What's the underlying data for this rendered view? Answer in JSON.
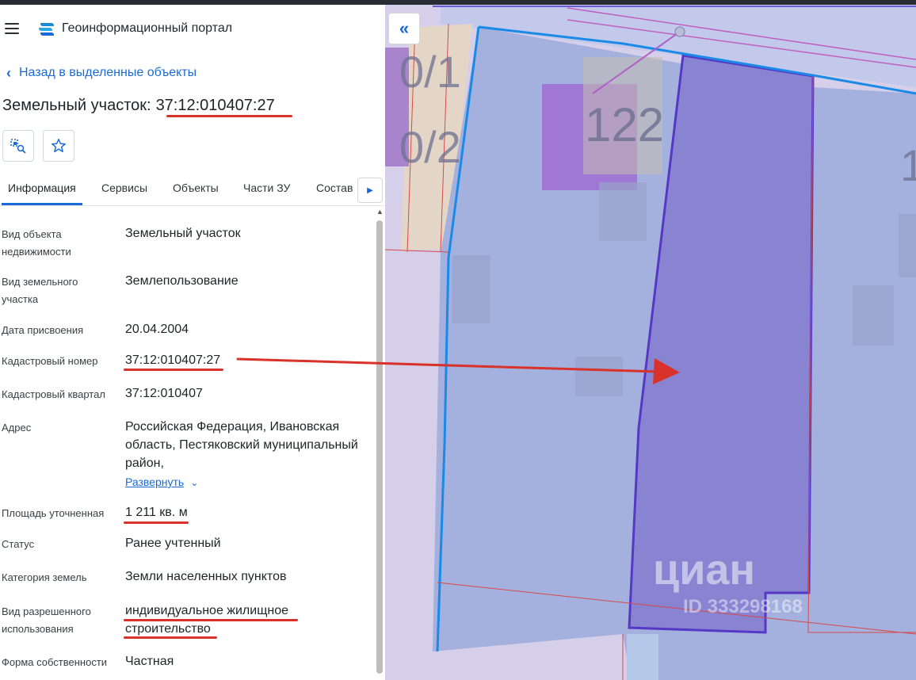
{
  "header": {
    "title": "Геоинформационный портал"
  },
  "back": {
    "label": "Назад в выделенные объекты"
  },
  "object": {
    "type": "Земельный участок:",
    "number": "37:12:010407:27"
  },
  "tabs": [
    "Информация",
    "Сервисы",
    "Объекты",
    "Части ЗУ",
    "Состав"
  ],
  "fields": [
    {
      "label": "Вид объекта недвижимости",
      "value": "Земельный участок"
    },
    {
      "label": "Вид земельного участка",
      "value": "Землепользование"
    },
    {
      "label": "Дата присвоения",
      "value": "20.04.2004"
    },
    {
      "label": "Кадастровый номер",
      "value": "37:12:010407:27"
    },
    {
      "label": "Кадастровый квартал",
      "value": "37:12:010407"
    },
    {
      "label": "Адрес",
      "value": "Российская Федерация, Ивановская область, Пестяковский муниципальный район,",
      "action": "Развернуть"
    },
    {
      "label": "Площадь уточненная",
      "value": "1 211 кв. м"
    },
    {
      "label": "Статус",
      "value": "Ранее учтенный"
    },
    {
      "label": "Категория земель",
      "value": "Земли населенных пунктов"
    },
    {
      "label": "Вид разрешенного использования",
      "value": "индивидуальное жилищное строительство"
    },
    {
      "label": "Форма собственности",
      "value": "Частная"
    }
  ],
  "map": {
    "parcel_labels": [
      "0/1",
      "0/2",
      "122",
      "1"
    ],
    "watermark": "циан",
    "watermark_id": "ID 333298168"
  },
  "colors": {
    "accent": "#1a6bd6",
    "annotation_red": "#d9322b",
    "selected_parcel": "#8a84d6"
  }
}
